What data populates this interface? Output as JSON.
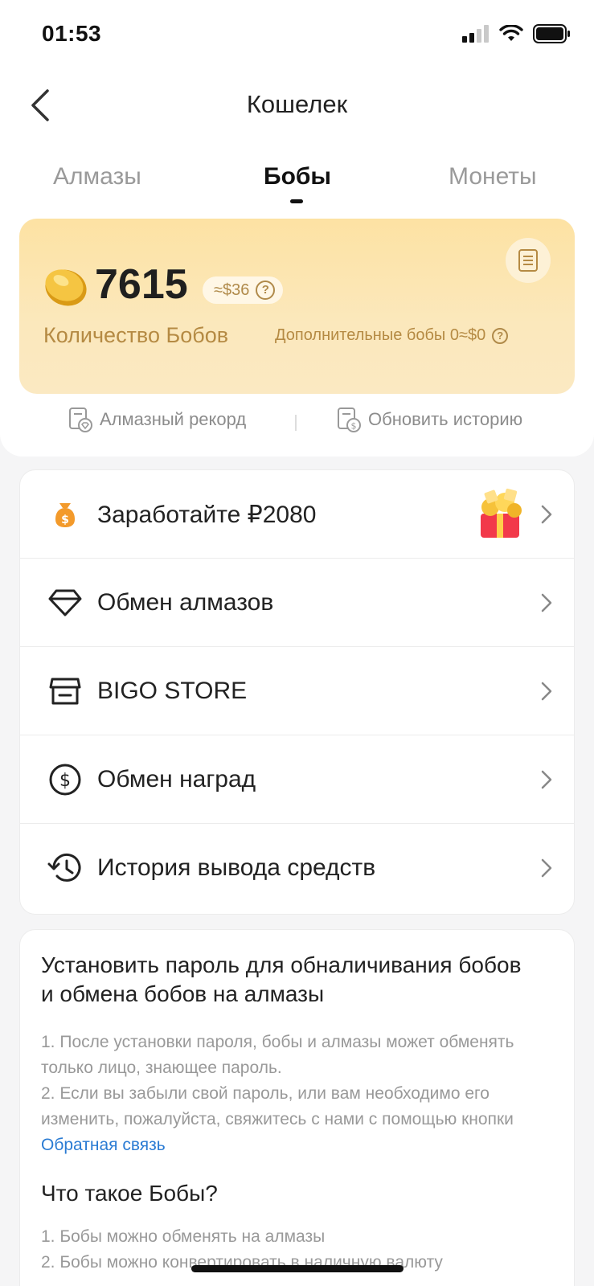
{
  "status_bar": {
    "time": "01:53"
  },
  "header": {
    "title": "Кошелек"
  },
  "tabs": [
    {
      "label": "Алмазы",
      "active": false
    },
    {
      "label": "Бобы",
      "active": true
    },
    {
      "label": "Монеты",
      "active": false
    }
  ],
  "beans_card": {
    "count": "7615",
    "usd_equiv": "≈$36",
    "label": "Количество Бобов",
    "extra": "Дополнительные бобы 0≈$0"
  },
  "links": {
    "diamond_record": "Алмазный рекорд",
    "update_history": "Обновить историю"
  },
  "menu": [
    {
      "label": "Заработайте ₽2080",
      "icon": "money-bag-icon"
    },
    {
      "label": "Обмен алмазов",
      "icon": "diamond-icon"
    },
    {
      "label": "BIGO STORE",
      "icon": "store-icon"
    },
    {
      "label": "Обмен наград",
      "icon": "dollar-icon"
    },
    {
      "label": "История вывода средств",
      "icon": "history-icon"
    }
  ],
  "info": {
    "title": "Установить пароль для обналичивания бобов и обмена бобов на алмазы",
    "line1": "1. После установки пароля, бобы и алмазы может обменять только лицо, знающее пароль.",
    "line2_prefix": "2. Если вы забыли свой пароль, или вам необходимо его изменить, пожалуйста, свяжитесь с нами с помощью кнопки",
    "line2_link": "Обратная связь",
    "subtitle": "Что такое Бобы?",
    "beans_line1": "1. Бобы можно обменять на алмазы",
    "beans_line2": "2. Бобы можно конвертировать в наличную валюту"
  },
  "colors": {
    "accent_gold": "#b58a43",
    "card_gradient_top": "#fde2a3",
    "link_blue": "#2a7bd3"
  }
}
